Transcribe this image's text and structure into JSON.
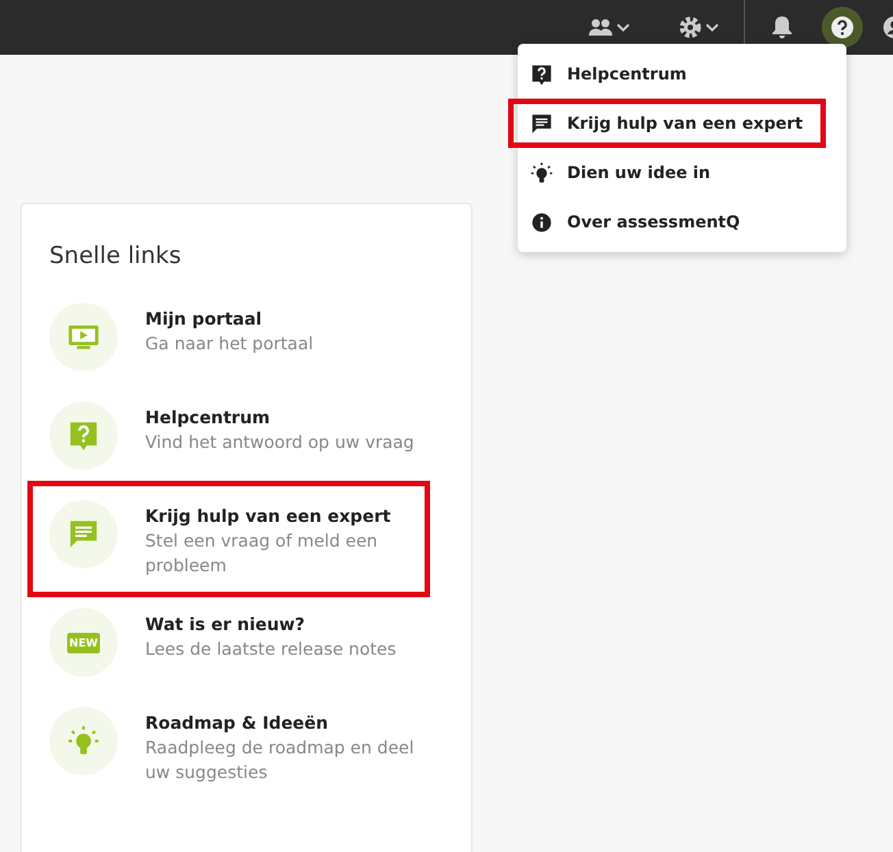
{
  "topbar": {
    "help_active": true
  },
  "help_menu": {
    "items": [
      {
        "kind": "help",
        "label": "Helpcentrum",
        "highlighted": false
      },
      {
        "kind": "chat",
        "label": "Krijg hulp van een expert",
        "highlighted": true
      },
      {
        "kind": "idea",
        "label": "Dien uw idee in",
        "highlighted": false
      },
      {
        "kind": "info",
        "label": "Over assessmentQ",
        "highlighted": false
      }
    ]
  },
  "quick_links": {
    "title": "Snelle links",
    "items": [
      {
        "kind": "portal",
        "title": "Mijn portaal",
        "subtitle": "Ga naar het portaal",
        "highlighted": false
      },
      {
        "kind": "help",
        "title": "Helpcentrum",
        "subtitle": "Vind het antwoord op uw vraag",
        "highlighted": false
      },
      {
        "kind": "chat",
        "title": "Krijg hulp van een expert",
        "subtitle": "Stel een vraag of meld een probleem",
        "highlighted": true
      },
      {
        "kind": "new",
        "badge": "NEW",
        "title": "Wat is er nieuw?",
        "subtitle": "Lees de laatste release notes",
        "highlighted": false
      },
      {
        "kind": "idea",
        "title": "Roadmap & Ideeën",
        "subtitle": "Raadpleeg de roadmap en deel uw suggesties",
        "highlighted": false
      }
    ]
  }
}
